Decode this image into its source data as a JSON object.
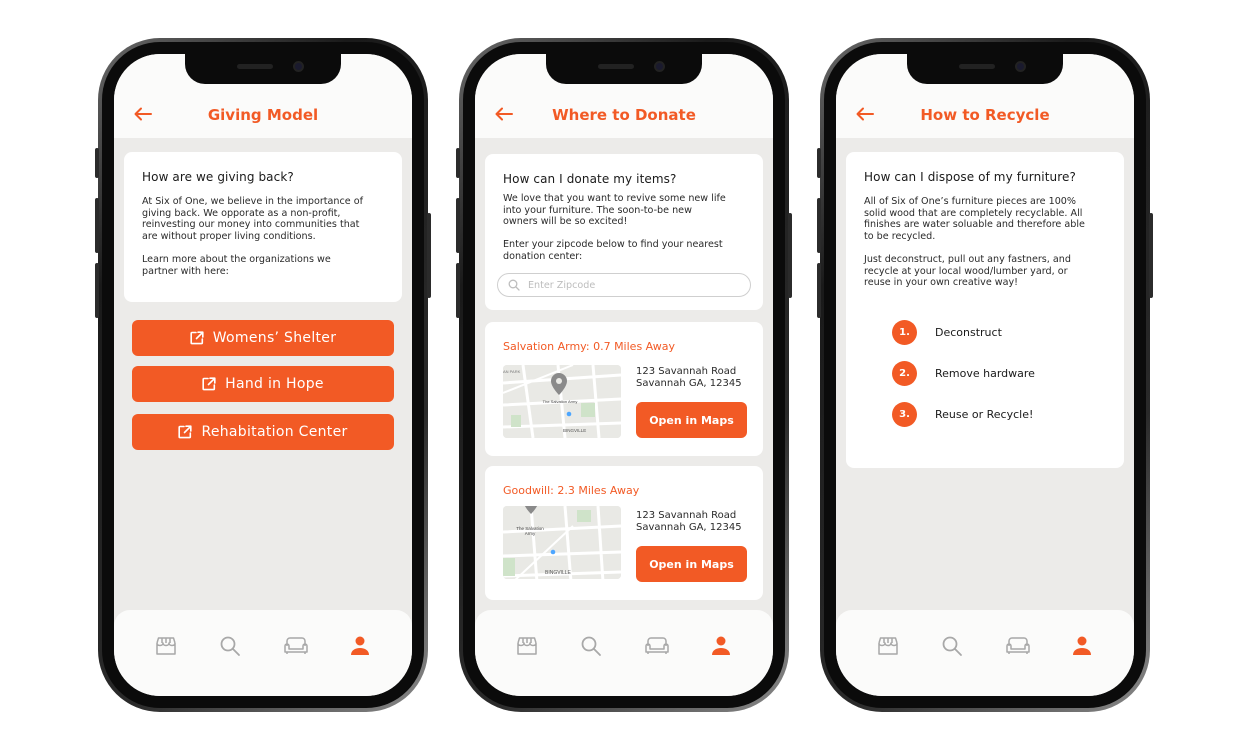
{
  "colors": {
    "accent": "#f25a25",
    "background": "#ecebe9",
    "card": "#ffffff",
    "text": "#1a1a1a"
  },
  "tabs": [
    "store-icon",
    "search-icon",
    "sofa-icon",
    "profile-icon"
  ],
  "phone1": {
    "title": "Giving Model",
    "card_title": "How are we giving back?",
    "card_body": "At Six of One, we believe in the importance of\ngiving back. We opporate as a non-profit,\nreinvesting our money into communities that\nare without proper living conditions.\n\nLearn more about the organizations we\npartner with here:",
    "buttons": [
      "Womens’ Shelter",
      "Hand in Hope",
      "Rehabitation Center"
    ]
  },
  "phone2": {
    "title": "Where to Donate",
    "card_title": "How can I donate my items?",
    "card_body": "We love that you want to revive some new life\ninto your furniture. The soon-to-be new\nowners will be so excited!\n\nEnter your zipcode below to find your nearest\ndonation center:",
    "search_placeholder": "Enter Zipcode",
    "locations": [
      {
        "name": "Salvation Army: 0.7 Miles Away",
        "address_line1": "123 Savannah Road",
        "address_line2": "Savannah GA, 12345",
        "button": "Open in Maps",
        "map_labels": [
          "The Salvation Army",
          "BINGVILLE",
          "AN PARK"
        ]
      },
      {
        "name": "Goodwill: 2.3 Miles Away",
        "address_line1": "123 Savannah Road",
        "address_line2": "Savannah GA, 12345",
        "button": "Open in Maps",
        "map_labels": [
          "The Salvation Army",
          "BINGVILLE"
        ]
      }
    ]
  },
  "phone3": {
    "title": "How to Recycle",
    "card_title": "How can I dispose of my furniture?",
    "card_body": "All of Six of One’s furniture pieces are 100%\nsolid wood that are completely recyclable. All\nfinishes are water soluable and therefore able\nto be recycled.\n\nJust deconstruct, pull out any fastners, and\nrecycle at your local wood/lumber yard, or\nreuse in your own creative way!",
    "steps": [
      {
        "num": "1.",
        "label": "Deconstruct"
      },
      {
        "num": "2.",
        "label": "Remove hardware"
      },
      {
        "num": "3.",
        "label": "Reuse or Recycle!"
      }
    ]
  }
}
